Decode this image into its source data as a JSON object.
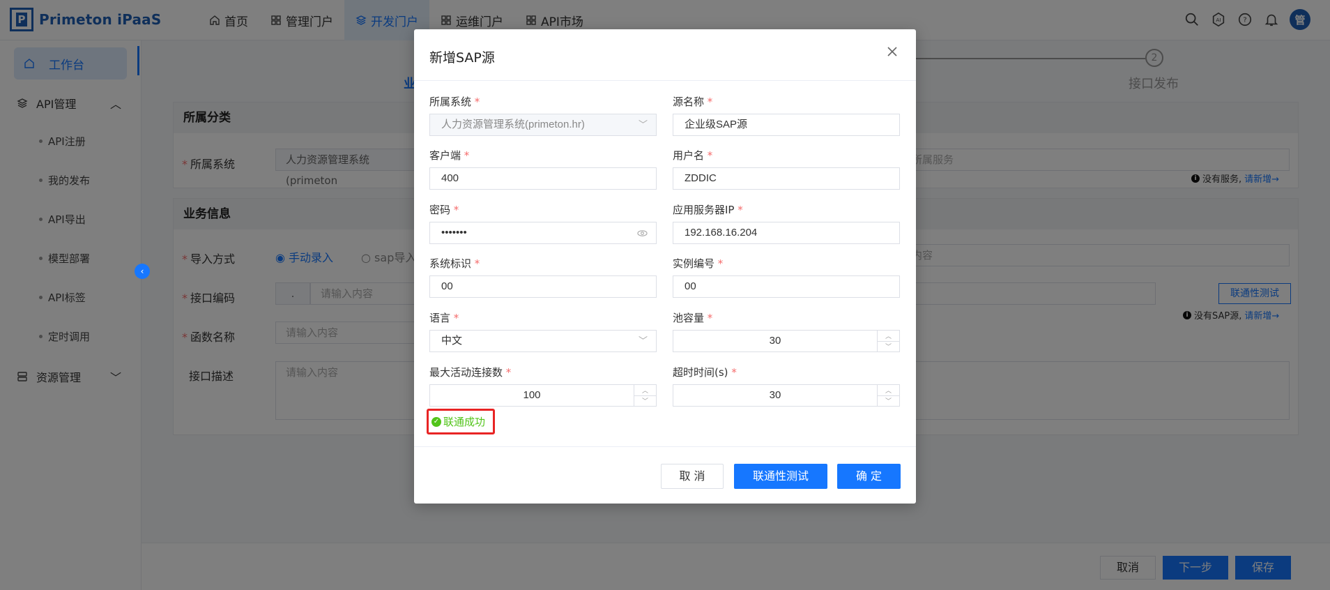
{
  "app": {
    "logo_letter": "P",
    "name": "Primeton iPaaS",
    "avatar": "管"
  },
  "nav": [
    {
      "label": "首页",
      "icon": "home-icon"
    },
    {
      "label": "管理门户",
      "icon": "grid-icon"
    },
    {
      "label": "开发门户",
      "icon": "layers-icon",
      "active": true
    },
    {
      "label": "运维门户",
      "icon": "grid-icon"
    },
    {
      "label": "API市场",
      "icon": "grid-icon"
    }
  ],
  "top_icons": [
    "search-icon",
    "ai-icon",
    "help-icon",
    "bell-icon"
  ],
  "sidebar": {
    "workbench": "工作台",
    "api_group": "API管理",
    "api_items": [
      "API注册",
      "我的发布",
      "API导出",
      "模型部署",
      "API标签",
      "定时调用"
    ],
    "resource_group": "资源管理"
  },
  "background": {
    "step_left": "业",
    "step_number": "2",
    "step_right": "接口发布",
    "section1": "所属分类",
    "sys_label": "所属系统",
    "sys_value": "人力资源管理系统(primeton",
    "service_placeholder": "所属服务",
    "no_service": "没有服务,",
    "add_new": "请新增→",
    "section2": "业务信息",
    "import_label": "导入方式",
    "import_manual": "手动录入",
    "import_sap": "sap导入",
    "content_placeholder": "内容",
    "code_label": "接口编码",
    "code_prefix": ".",
    "input_placeholder": "请输入内容",
    "conn_test": "联通性测试",
    "no_sap": "没有SAP源,",
    "func_label": "函数名称",
    "desc_label": "接口描述",
    "cancel": "取消",
    "next": "下一步",
    "save": "保存"
  },
  "modal": {
    "title": "新增SAP源",
    "fields": {
      "system": {
        "label": "所属系统",
        "value": "人力资源管理系统(primeton.hr)"
      },
      "source_name": {
        "label": "源名称",
        "value": "企业级SAP源"
      },
      "client": {
        "label": "客户端",
        "value": "400"
      },
      "username": {
        "label": "用户名",
        "value": "ZDDIC"
      },
      "password": {
        "label": "密码",
        "value": "•••••••"
      },
      "server_ip": {
        "label": "应用服务器IP",
        "value": "192.168.16.204"
      },
      "system_id": {
        "label": "系统标识",
        "value": "00"
      },
      "instance_no": {
        "label": "实例编号",
        "value": "00"
      },
      "language": {
        "label": "语言",
        "value": "中文"
      },
      "pool_size": {
        "label": "池容量",
        "value": "30"
      },
      "max_conn": {
        "label": "最大活动连接数",
        "value": "100"
      },
      "timeout": {
        "label": "超时时间(s)",
        "value": "30"
      }
    },
    "success_text": "联通成功",
    "cancel": "取 消",
    "test": "联通性测试",
    "confirm": "确 定"
  },
  "colors": {
    "primary": "#1677ff",
    "brand": "#1e5fb4",
    "success": "#52c41a",
    "highlight": "#e82424"
  }
}
